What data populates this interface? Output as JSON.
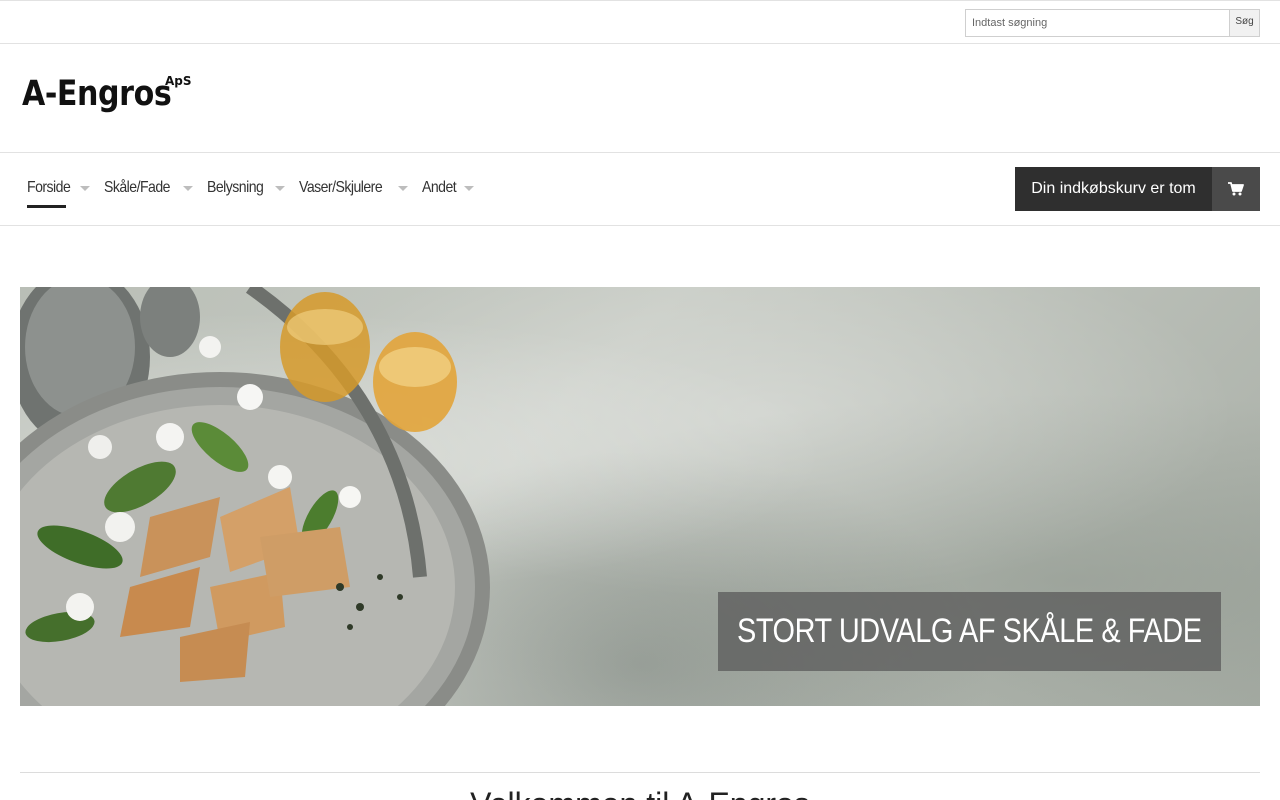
{
  "search": {
    "placeholder": "Indtast søgning",
    "button_label": "Søg"
  },
  "logo": {
    "main": "A-Engros",
    "sup": "ApS"
  },
  "nav": {
    "items": [
      {
        "label": "Forside",
        "active": true
      },
      {
        "label": "Skåle/Fade"
      },
      {
        "label": "Belysning"
      },
      {
        "label": "Vaser/Skjulere"
      },
      {
        "label": "Andet"
      }
    ]
  },
  "cart": {
    "label": "Din indkøbskurv er tom",
    "icon": "cart-icon"
  },
  "banner": {
    "caption": "STORT UDVALG AF SKÅLE & FADE"
  },
  "welcome": {
    "title": "Velkommen til A-Engros"
  }
}
